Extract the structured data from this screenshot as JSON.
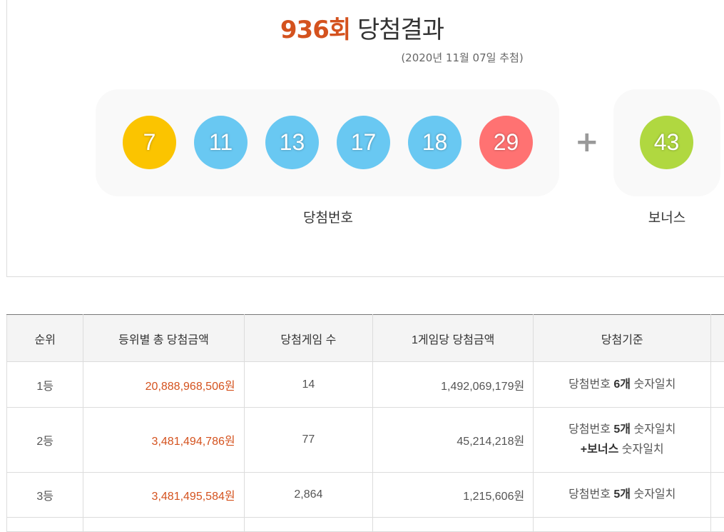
{
  "header": {
    "round": "936회",
    "title_suffix": "당첨결과",
    "draw_date": "(2020년 11월 07일 추첨)"
  },
  "winning": {
    "numbers": [
      {
        "value": "7",
        "color": "#fbc400"
      },
      {
        "value": "11",
        "color": "#69c8f2"
      },
      {
        "value": "13",
        "color": "#69c8f2"
      },
      {
        "value": "17",
        "color": "#69c8f2"
      },
      {
        "value": "18",
        "color": "#69c8f2"
      },
      {
        "value": "29",
        "color": "#ff7272"
      }
    ],
    "plus": "+",
    "caption": "당첨번호"
  },
  "bonus": {
    "value": "43",
    "color": "#b0d840",
    "caption": "보너스"
  },
  "table": {
    "headers": [
      "순위",
      "등위별 총 당첨금액",
      "당첨게임 수",
      "1게임당 당첨금액",
      "당첨기준"
    ],
    "rows": [
      {
        "rank": "1등",
        "total": "20,888,968,506원",
        "winners": "14",
        "per_game": "1,492,069,179원",
        "crit1_a": "당첨번호 ",
        "crit1_b": "6개",
        "crit1_c": " 숫자일치",
        "crit2_a": "",
        "crit2_b": ""
      },
      {
        "rank": "2등",
        "total": "3,481,494,786원",
        "winners": "77",
        "per_game": "45,214,218원",
        "crit1_a": "당첨번호 ",
        "crit1_b": "5개",
        "crit1_c": " 숫자일치",
        "crit2_a": "+보너스",
        "crit2_b": " 숫자일치"
      },
      {
        "rank": "3등",
        "total": "3,481,495,584원",
        "winners": "2,864",
        "per_game": "1,215,606원",
        "crit1_a": "당첨번호 ",
        "crit1_b": "5개",
        "crit1_c": " 숫자일치",
        "crit2_a": "",
        "crit2_b": ""
      }
    ]
  }
}
